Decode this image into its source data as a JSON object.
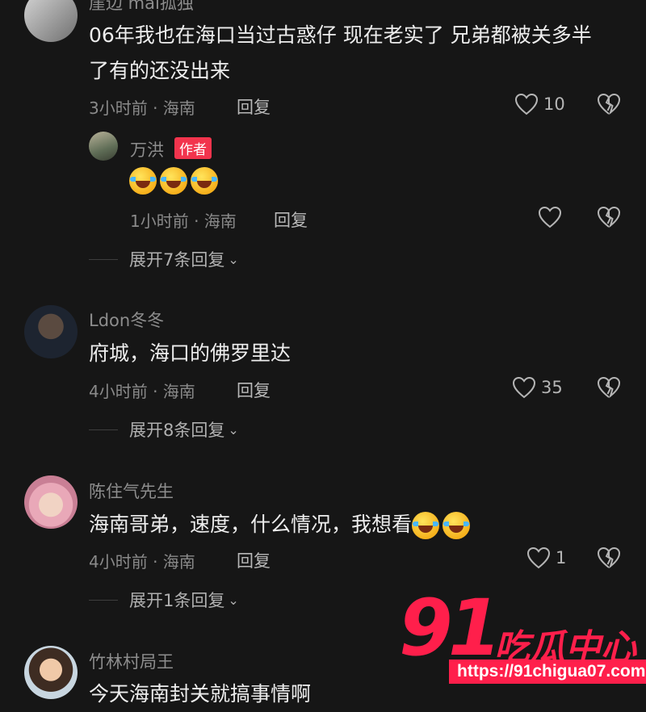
{
  "comments": [
    {
      "author": "崖边 mai孤独",
      "text_line1": "06年我也在海口当过古惑仔 现在老实了 兄弟都被关多半",
      "text_line2": "了有的还没出来",
      "meta": "3小时前 · 海南",
      "reply_label": "回复",
      "likes": "10"
    },
    {
      "author": "Ldon冬冬",
      "text": "府城，海口的佛罗里达",
      "meta": "4小时前 · 海南",
      "reply_label": "回复",
      "likes": "35",
      "expand": "展开8条回复"
    },
    {
      "author": "陈住气先生",
      "text": "海南哥弟，速度，什么情况，我想看",
      "meta": "4小时前 · 海南",
      "reply_label": "回复",
      "likes": "1",
      "expand": "展开1条回复"
    },
    {
      "author": "竹林村局王",
      "text": "今天海南封关就搞事情啊"
    }
  ],
  "author_reply": {
    "author": "万洪",
    "badge": "作者",
    "meta": "1小时前 · 海南",
    "reply_label": "回复",
    "expand": "展开7条回复"
  },
  "watermark": {
    "number": "91",
    "brand": "吃瓜中心",
    "url": "https://91chigua07.com"
  },
  "colors": {
    "background": "#161616",
    "badge": "#f2344d",
    "watermark": "#ff1f4b"
  }
}
